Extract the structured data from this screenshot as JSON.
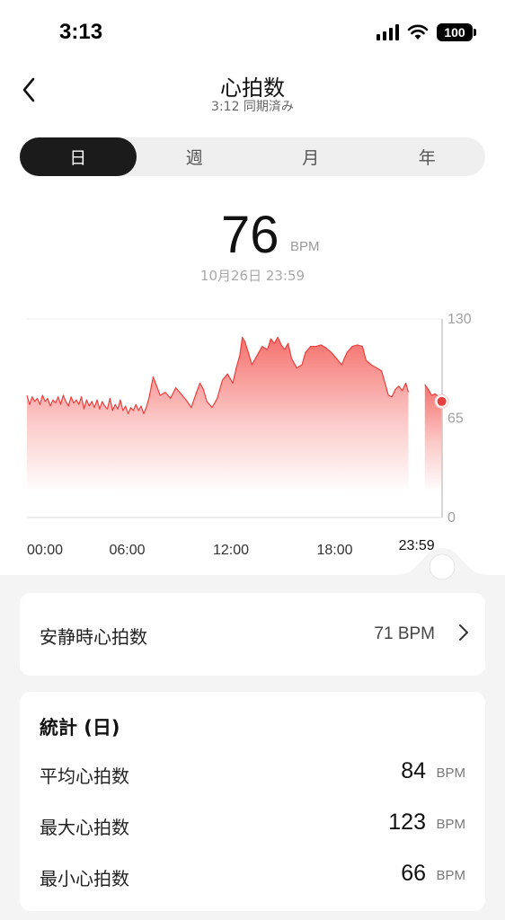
{
  "status": {
    "time": "3:13",
    "battery": "100"
  },
  "header": {
    "title": "心拍数",
    "subtitle": "3:12 同期済み"
  },
  "tabs": [
    {
      "label": "日",
      "active": true
    },
    {
      "label": "週",
      "active": false
    },
    {
      "label": "月",
      "active": false
    },
    {
      "label": "年",
      "active": false
    }
  ],
  "reading": {
    "value": "76",
    "unit": "BPM",
    "datetime": "10月26日 23:59"
  },
  "chart_data": {
    "type": "area",
    "x_unit": "hours",
    "x_tick_labels": [
      "00:00",
      "06:00",
      "12:00",
      "18:00"
    ],
    "x_ticks": [
      0,
      6,
      12,
      18
    ],
    "y_tick_labels": [
      "130",
      "65",
      "0"
    ],
    "y_ticks": [
      130,
      65,
      0
    ],
    "ylim": [
      0,
      130
    ],
    "xlim": [
      0,
      24
    ],
    "current": {
      "x": 23.98,
      "y": 76,
      "label": "23:59"
    },
    "gaps": [
      [
        22.2,
        22.8
      ]
    ],
    "points": [
      [
        0.0,
        80
      ],
      [
        0.15,
        74
      ],
      [
        0.3,
        79
      ],
      [
        0.45,
        76
      ],
      [
        0.6,
        78
      ],
      [
        0.75,
        74
      ],
      [
        0.9,
        80
      ],
      [
        1.05,
        76
      ],
      [
        1.2,
        78
      ],
      [
        1.35,
        73
      ],
      [
        1.5,
        77
      ],
      [
        1.65,
        75
      ],
      [
        1.8,
        79
      ],
      [
        1.95,
        74
      ],
      [
        2.1,
        80
      ],
      [
        2.25,
        76
      ],
      [
        2.4,
        73
      ],
      [
        2.55,
        79
      ],
      [
        2.7,
        75
      ],
      [
        2.85,
        77
      ],
      [
        3.0,
        74
      ],
      [
        3.15,
        79
      ],
      [
        3.3,
        71
      ],
      [
        3.45,
        77
      ],
      [
        3.6,
        73
      ],
      [
        3.75,
        76
      ],
      [
        3.9,
        72
      ],
      [
        4.05,
        77
      ],
      [
        4.2,
        71
      ],
      [
        4.35,
        76
      ],
      [
        4.5,
        73
      ],
      [
        4.65,
        71
      ],
      [
        4.8,
        78
      ],
      [
        4.95,
        70
      ],
      [
        5.1,
        74
      ],
      [
        5.25,
        71
      ],
      [
        5.4,
        77
      ],
      [
        5.55,
        70
      ],
      [
        5.7,
        73
      ],
      [
        5.85,
        68
      ],
      [
        6.0,
        72
      ],
      [
        6.15,
        70
      ],
      [
        6.3,
        74
      ],
      [
        6.45,
        70
      ],
      [
        6.6,
        73
      ],
      [
        6.75,
        68
      ],
      [
        6.9,
        72
      ],
      [
        7.05,
        78
      ],
      [
        7.3,
        92
      ],
      [
        7.5,
        86
      ],
      [
        7.7,
        80
      ],
      [
        8.0,
        82
      ],
      [
        8.3,
        78
      ],
      [
        8.6,
        85
      ],
      [
        8.9,
        81
      ],
      [
        9.2,
        77
      ],
      [
        9.5,
        72
      ],
      [
        9.8,
        82
      ],
      [
        10.0,
        88
      ],
      [
        10.2,
        84
      ],
      [
        10.4,
        76
      ],
      [
        10.7,
        72
      ],
      [
        11.0,
        78
      ],
      [
        11.3,
        90
      ],
      [
        11.6,
        94
      ],
      [
        11.9,
        88
      ],
      [
        12.1,
        98
      ],
      [
        12.3,
        106
      ],
      [
        12.45,
        118
      ],
      [
        12.6,
        115
      ],
      [
        12.8,
        108
      ],
      [
        13.0,
        100
      ],
      [
        13.3,
        106
      ],
      [
        13.6,
        112
      ],
      [
        13.9,
        110
      ],
      [
        14.1,
        117
      ],
      [
        14.3,
        114
      ],
      [
        14.5,
        118
      ],
      [
        14.7,
        113
      ],
      [
        14.9,
        110
      ],
      [
        15.1,
        114
      ],
      [
        15.3,
        104
      ],
      [
        15.6,
        98
      ],
      [
        15.9,
        100
      ],
      [
        16.1,
        108
      ],
      [
        16.4,
        112
      ],
      [
        16.7,
        112
      ],
      [
        17.0,
        113
      ],
      [
        17.3,
        111
      ],
      [
        17.6,
        108
      ],
      [
        17.9,
        104
      ],
      [
        18.2,
        100
      ],
      [
        18.5,
        108
      ],
      [
        18.8,
        112
      ],
      [
        19.1,
        113
      ],
      [
        19.4,
        112
      ],
      [
        19.6,
        103
      ],
      [
        19.9,
        100
      ],
      [
        20.2,
        98
      ],
      [
        20.5,
        96
      ],
      [
        20.7,
        88
      ],
      [
        20.9,
        80
      ],
      [
        21.1,
        79
      ],
      [
        21.3,
        84
      ],
      [
        21.5,
        86
      ],
      [
        21.7,
        83
      ],
      [
        21.9,
        88
      ],
      [
        22.05,
        82
      ],
      [
        23.0,
        87
      ],
      [
        23.2,
        84
      ],
      [
        23.4,
        80
      ],
      [
        23.6,
        81
      ],
      [
        23.8,
        79
      ],
      [
        23.98,
        76
      ]
    ]
  },
  "resting": {
    "label": "安静時心拍数",
    "value": "71 BPM"
  },
  "stats": {
    "title": "統計 (日)",
    "rows": [
      {
        "label": "平均心拍数",
        "value": "84",
        "unit": "BPM"
      },
      {
        "label": "最大心拍数",
        "value": "123",
        "unit": "BPM"
      },
      {
        "label": "最小心拍数",
        "value": "66",
        "unit": "BPM"
      }
    ]
  },
  "colors": {
    "accent": "#e8403e",
    "fill_top": "#f46a66",
    "dark": "#1b1b1b"
  }
}
